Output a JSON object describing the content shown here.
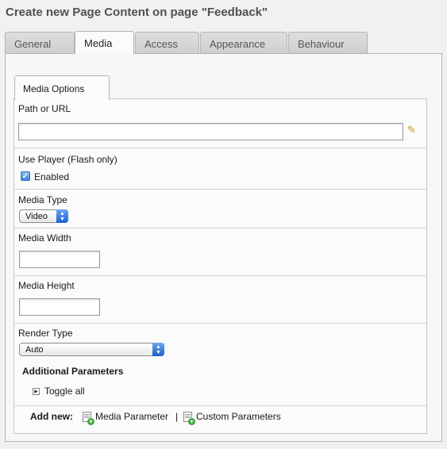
{
  "page": {
    "title": "Create new Page Content on page \"Feedback\""
  },
  "tabs": [
    "General",
    "Media",
    "Access",
    "Appearance",
    "Behaviour"
  ],
  "subtab": {
    "label": "Media Options"
  },
  "fields": {
    "path": {
      "label": "Path or URL",
      "value": ""
    },
    "use_player": {
      "label": "Use Player (Flash only)",
      "checkbox_label": "Enabled",
      "checked": true
    },
    "media_type": {
      "label": "Media Type",
      "value": "Video"
    },
    "media_width": {
      "label": "Media Width",
      "value": ""
    },
    "media_height": {
      "label": "Media Height",
      "value": ""
    },
    "render_type": {
      "label": "Render Type",
      "value": "Auto"
    }
  },
  "additional": {
    "title": "Additional Parameters",
    "toggle_label": "Toggle all",
    "add_new_label": "Add new:",
    "media_parameter_label": "Media Parameter",
    "separator": "|",
    "custom_parameters_label": "Custom Parameters"
  },
  "icons": {
    "wizard": "wand-wizard-icon",
    "toggle": "expand-triangle-icon",
    "add": "add-document-icon"
  },
  "colors": {
    "select_accent": "#1a5fce",
    "checkbox_accent": "#3e82dd",
    "add_icon_green": "#3fa53a"
  }
}
